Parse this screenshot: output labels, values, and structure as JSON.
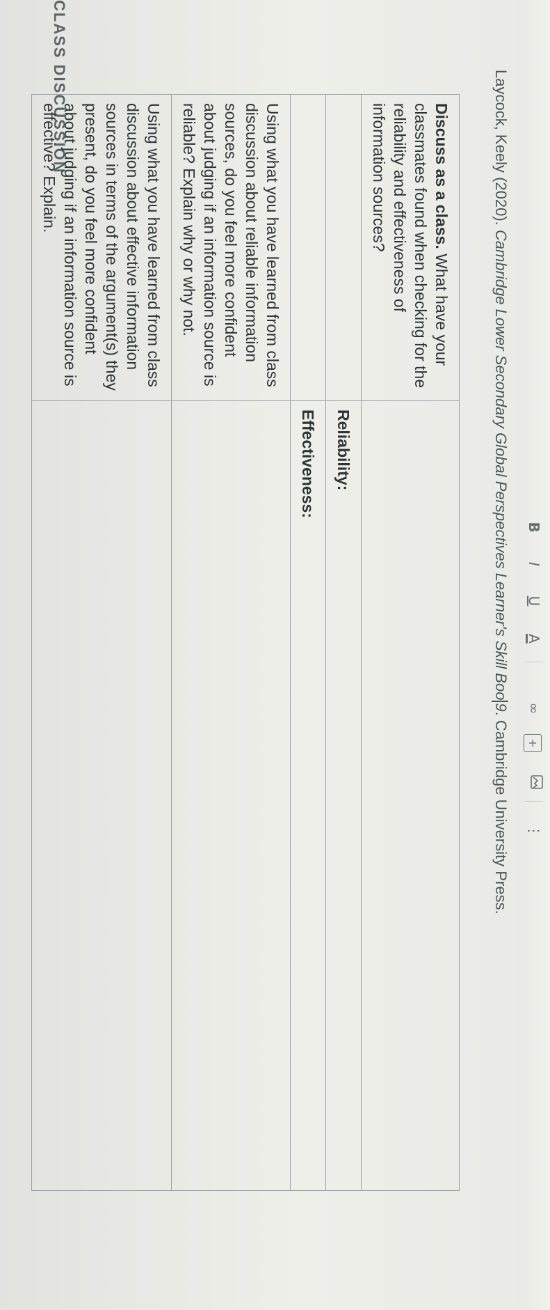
{
  "section": {
    "title": "CLASS DISCUSSION"
  },
  "table": {
    "prompt_lead": "Discuss as a class.",
    "prompt_rest": " What have your classmates found when checking for the reliability and effectiveness of information sources?",
    "reliability_label": "Reliability:",
    "effectiveness_label": "Effectiveness:",
    "question_1": "Using what you have learned from class discussion about reliable information sources, do you feel more confident about judging if an information source is reliable? Explain why or why not.",
    "question_2": "Using what you have learned from class discussion about effective information sources in terms of the argument(s) they present, do you feel more confident about judging if an information source is effective? Explain."
  },
  "citation": {
    "author": "Laycock, Keely (2020). ",
    "book_title_a": "Cambridge Lower Secondary Global Perspectives Learner's Skill Boo",
    "book_title_b": "9",
    "publisher": ". Cambridge University Press."
  },
  "toolbar": {
    "bold": "B",
    "italic": "I",
    "underline": "U",
    "font_color": "A",
    "link": "∞",
    "add": "+",
    "more": "⋮"
  }
}
